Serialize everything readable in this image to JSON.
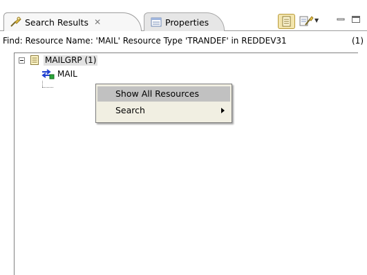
{
  "tabs": {
    "search_results": {
      "label": "Search Results",
      "close_glyph": "✕",
      "icon": "search-results-icon"
    },
    "properties": {
      "label": "Properties",
      "icon": "properties-icon"
    }
  },
  "toolbar": {
    "primary_icon": "pin-results-icon",
    "secondary_icon": "search-history-icon",
    "menu_arrow": "▼"
  },
  "find_line": {
    "text": "Find: Resource Name: 'MAIL' Resource Type 'TRANDEF' in REDDEV31",
    "count": "(1)"
  },
  "tree": {
    "root_label": "MAILGRP (1)",
    "child_label": "MAIL"
  },
  "context_menu": {
    "items": [
      {
        "label": "Show All Resources"
      },
      {
        "label": "Search"
      }
    ]
  },
  "colors": {
    "menu_background": "#f1efe2",
    "menu_highlight": "#c1c1c1",
    "tab_active_background": "#f7f7f7",
    "pin_button_background": "#f3e5ad"
  }
}
